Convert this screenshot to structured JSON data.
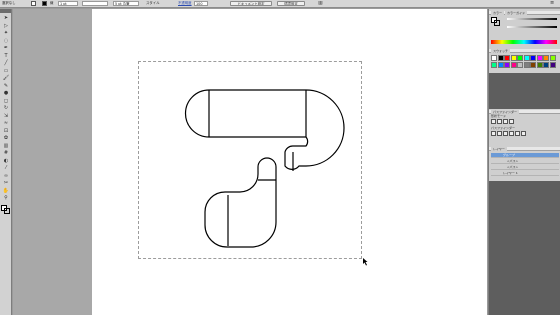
{
  "control_bar": {
    "selection_label": "選択なし",
    "stroke_label": "線",
    "stroke_weight": "1 pt",
    "brush_label": "5 pt 丸筆",
    "style_label": "スタイル",
    "opacity_label": "不透明度",
    "opacity_value": "100",
    "doc_setup_button": "ドキュメント設定",
    "preferences_button": "環境設定"
  },
  "tools": [
    "arrow",
    "direct",
    "wand",
    "lasso",
    "pen",
    "type",
    "line",
    "rect",
    "brush",
    "pencil",
    "blob",
    "eraser",
    "rotate",
    "scale",
    "warp",
    "free",
    "symbol",
    "graph",
    "mesh",
    "gradient",
    "eyedrop",
    "blend",
    "slice",
    "hand",
    "zoom"
  ],
  "panels": {
    "color": {
      "tabs": [
        "カラー",
        "カラーガイド"
      ]
    },
    "swatches": {
      "tabs": [
        "スウォッチ"
      ],
      "swatch_colors": [
        "#ffffff",
        "#000000",
        "#ff0000",
        "#ffff00",
        "#00ff00",
        "#00ffff",
        "#0000ff",
        "#ff00ff",
        "#ff8800",
        "#88ff00",
        "#00ff88",
        "#0088ff",
        "#8800ff",
        "#ff0088",
        "#c0c0c0",
        "#808080",
        "#804000",
        "#408000",
        "#004080",
        "#400080"
      ]
    },
    "pathfinder": {
      "tabs": [
        "パスファインダー"
      ],
      "shape_modes_label": "形状モード",
      "pathfinders_label": "パスファインダー"
    },
    "layers": {
      "tabs": [
        "レイヤー"
      ],
      "rows": [
        "グループ",
        "<パス>",
        "<パス>",
        "レイヤー 1"
      ]
    }
  },
  "artwork": {
    "stroke_color": "#000000",
    "artboard_border": "#9c9c9c"
  }
}
